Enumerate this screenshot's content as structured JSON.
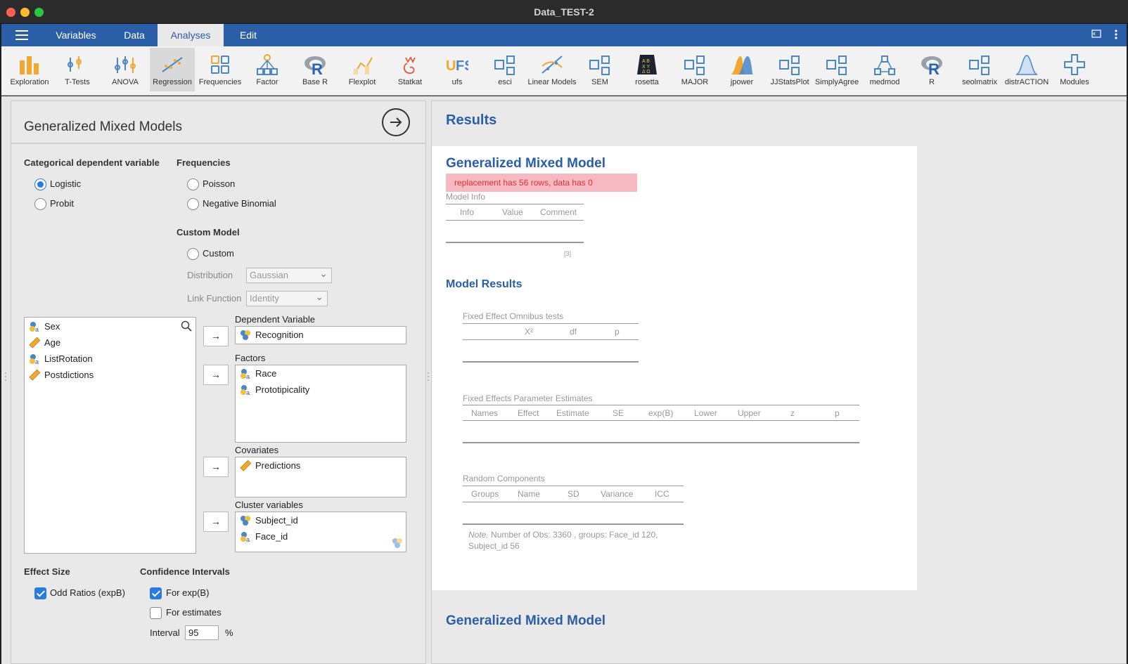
{
  "window": {
    "title": "Data_TEST-2"
  },
  "tabs": [
    "Variables",
    "Data",
    "Analyses",
    "Edit"
  ],
  "active_tab": "Analyses",
  "ribbon": [
    {
      "label": "Exploration",
      "icon": "exploration-icon"
    },
    {
      "label": "T-Tests",
      "icon": "t-tests-icon"
    },
    {
      "label": "ANOVA",
      "icon": "anova-icon"
    },
    {
      "label": "Regression",
      "icon": "regression-icon"
    },
    {
      "label": "Frequencies",
      "icon": "frequencies-icon"
    },
    {
      "label": "Factor",
      "icon": "factor-icon"
    },
    {
      "label": "Base R",
      "icon": "base-r-icon"
    },
    {
      "label": "Flexplot",
      "icon": "flexplot-icon"
    },
    {
      "label": "Statkat",
      "icon": "statkat-icon"
    },
    {
      "label": "ufs",
      "icon": "ufs-icon"
    },
    {
      "label": "esci",
      "icon": "esci-icon"
    },
    {
      "label": "Linear Models",
      "icon": "linear-models-icon"
    },
    {
      "label": "SEM",
      "icon": "sem-icon"
    },
    {
      "label": "rosetta",
      "icon": "rosetta-icon"
    },
    {
      "label": "MAJOR",
      "icon": "major-icon"
    },
    {
      "label": "jpower",
      "icon": "jpower-icon"
    },
    {
      "label": "JJStatsPlot",
      "icon": "jjstatsplot-icon"
    },
    {
      "label": "SimplyAgree",
      "icon": "simplyagree-icon"
    },
    {
      "label": "medmod",
      "icon": "medmod-icon"
    },
    {
      "label": "R",
      "icon": "r-icon"
    },
    {
      "label": "seolmatrix",
      "icon": "seolmatrix-icon"
    },
    {
      "label": "distrACTION",
      "icon": "distraction-icon"
    },
    {
      "label": "Modules",
      "icon": "modules-icon"
    }
  ],
  "options": {
    "title": "Generalized Mixed Models",
    "categorical": {
      "header": "Categorical dependent variable",
      "logistic": "Logistic",
      "probit": "Probit",
      "selected": "Logistic"
    },
    "frequencies": {
      "header": "Frequencies",
      "poisson": "Poisson",
      "negative_binomial": "Negative Binomial"
    },
    "custom_model": {
      "header": "Custom Model",
      "custom": "Custom",
      "distribution_label": "Distribution",
      "distribution_value": "Gaussian",
      "link_label": "Link Function",
      "link_value": "Identity"
    },
    "available_variables": [
      {
        "name": "Sex",
        "type": "nominal"
      },
      {
        "name": "Age",
        "type": "scale"
      },
      {
        "name": "ListRotation",
        "type": "nominal"
      },
      {
        "name": "Postdictions",
        "type": "scale"
      }
    ],
    "arrow": "→",
    "dependent": {
      "label": "Dependent Variable",
      "items": [
        "Recognition"
      ]
    },
    "factors": {
      "label": "Factors",
      "items": [
        "Race",
        "Prototipicality"
      ]
    },
    "covariates": {
      "label": "Covariates",
      "items": [
        "Predictions"
      ]
    },
    "clusters": {
      "label": "Cluster variables",
      "items": [
        "Subject_id",
        "Face_id"
      ]
    },
    "effect_size": {
      "header": "Effect Size",
      "odd_ratios": "Odd Ratios (expB)",
      "odd_ratios_checked": true
    },
    "confidence": {
      "header": "Confidence Intervals",
      "for_expb": "For exp(B)",
      "for_expb_checked": true,
      "for_estimates": "For estimates",
      "for_estimates_checked": false,
      "interval_label": "Interval",
      "interval_value": "95",
      "percent": "%"
    }
  },
  "results": {
    "heading": "Results",
    "model_title": "Generalized Mixed Model",
    "error": "replacement has 56 rows, data has 0",
    "model_info": {
      "caption": "Model Info",
      "columns": [
        "Info",
        "Value",
        "Comment"
      ],
      "footnote": "[3]"
    },
    "model_results_heading": "Model Results",
    "omnibus": {
      "caption": "Fixed Effect Omnibus tests",
      "columns": [
        "X²",
        "df",
        "p"
      ]
    },
    "params": {
      "caption": "Fixed Effects Parameter Estimates",
      "columns": [
        "Names",
        "Effect",
        "Estimate",
        "SE",
        "exp(B)",
        "Lower",
        "Upper",
        "z",
        "p"
      ]
    },
    "random": {
      "caption": "Random Components",
      "columns": [
        "Groups",
        "Name",
        "SD",
        "Variance",
        "ICC"
      ]
    },
    "note_label": "Note.",
    "note_text": " Number of Obs: 3360 , groups: Face_id 120,",
    "note_text2": "Subject_id 56",
    "second_title": "Generalized Mixed Model"
  },
  "colors": {
    "accent": "#2a5ea6",
    "error_bg": "#f6b8c1",
    "error_text": "#dd3333",
    "check": "#2b7bdf"
  }
}
